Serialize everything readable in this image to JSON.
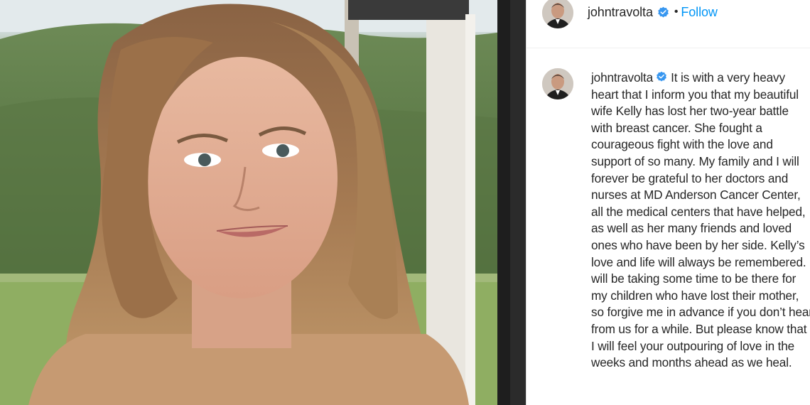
{
  "post": {
    "username": "johntravolta",
    "follow_label": "Follow",
    "separator": "•",
    "caption": "It is with a very heavy heart that I inform you that my beautiful wife Kelly has lost her two-year battle with breast cancer. She fought a courageous fight with the love and support of so many.  My family and I will forever be grateful to her doctors and nurses at MD Anderson Cancer Center, all the medical centers that have helped, as well as her many friends and loved ones who have been by her side. Kelly’s love and life will always be remembered. I will be taking some time to be there for my children who have lost their mother, so forgive me in advance if you don’t hear from us for a while.  But please know that I will feel your outpouring of love in the weeks and months ahead as we heal."
  },
  "colors": {
    "link": "#0095f6",
    "text": "#262626",
    "verified": "#3897f0"
  },
  "icons": {
    "verified": "verified-badge-icon"
  }
}
